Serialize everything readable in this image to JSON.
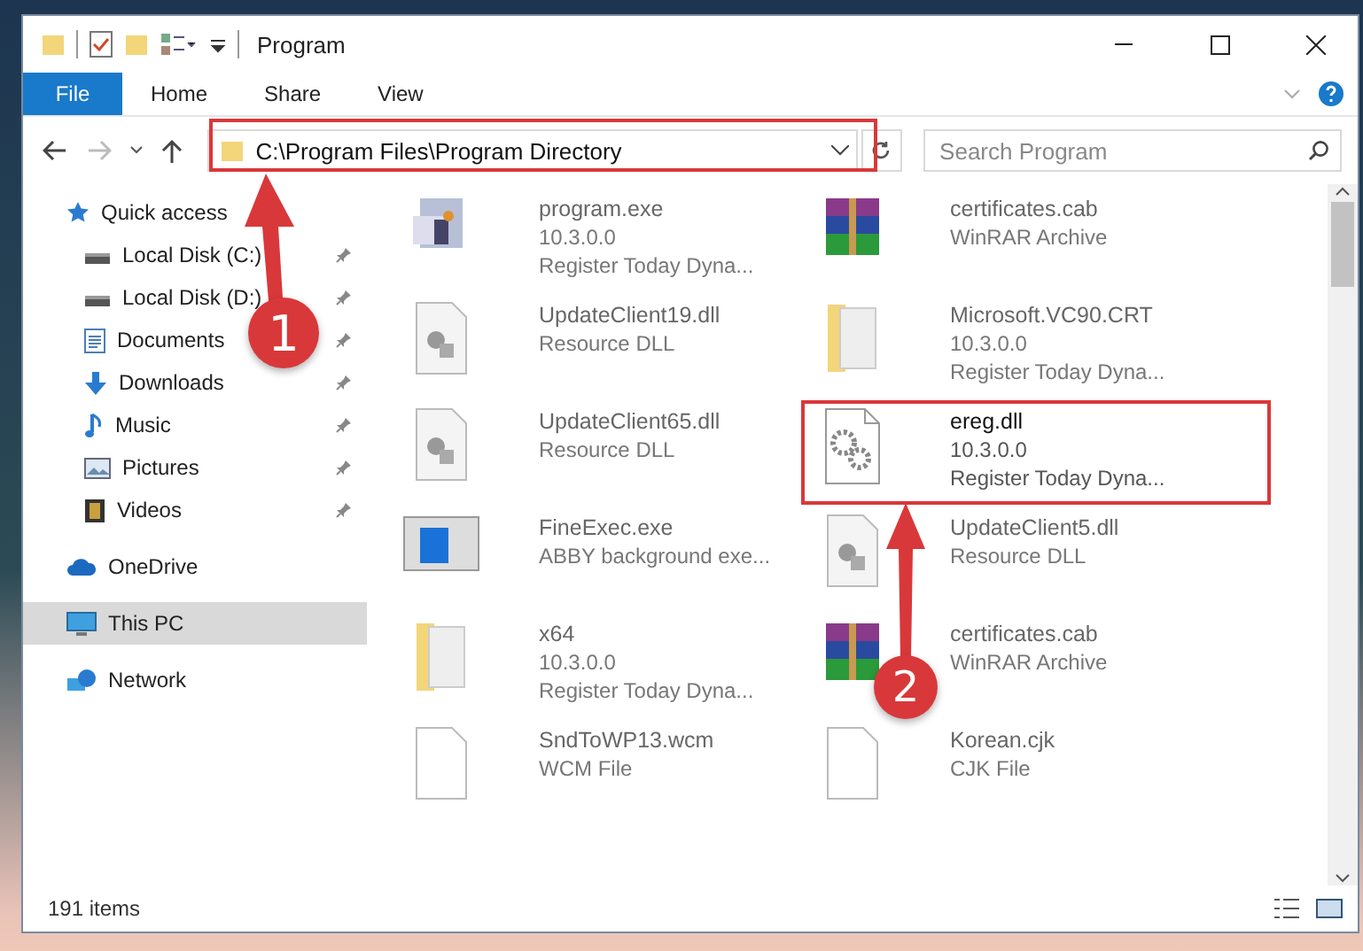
{
  "window": {
    "title": "Program"
  },
  "ribbon_tabs": [
    {
      "label": "File",
      "selected": true
    },
    {
      "label": "Home",
      "selected": false
    },
    {
      "label": "Share",
      "selected": false
    },
    {
      "label": "View",
      "selected": false
    }
  ],
  "address": {
    "path": "C:\\Program Files\\Program Directory"
  },
  "search": {
    "placeholder": "Search Program"
  },
  "sidebar": {
    "items": [
      {
        "label": "Quick access",
        "kind": "star",
        "pinned": false,
        "selected": false,
        "children": [
          {
            "label": "Local Disk (C:)",
            "kind": "disk",
            "pinned": true,
            "selected": false
          },
          {
            "label": "Local Disk (D:)",
            "kind": "disk",
            "pinned": true,
            "selected": false
          },
          {
            "label": "Documents",
            "kind": "document",
            "pinned": true,
            "selected": false
          },
          {
            "label": "Downloads",
            "kind": "download",
            "pinned": true,
            "selected": false
          },
          {
            "label": "Music",
            "kind": "music",
            "pinned": true,
            "selected": false
          },
          {
            "label": "Pictures",
            "kind": "pictures",
            "pinned": true,
            "selected": false
          },
          {
            "label": "Videos",
            "kind": "videos",
            "pinned": true,
            "selected": false
          }
        ]
      },
      {
        "label": "OneDrive",
        "kind": "cloud",
        "pinned": false,
        "selected": false
      },
      {
        "label": "This PC",
        "kind": "pc",
        "pinned": false,
        "selected": true
      },
      {
        "label": "Network",
        "kind": "network",
        "pinned": false,
        "selected": false
      }
    ]
  },
  "files": [
    {
      "name": "program.exe",
      "details": [
        "10.3.0.0",
        "Register Today Dyna..."
      ],
      "kind": "app",
      "blurred": true
    },
    {
      "name": "certificates.cab",
      "details": [
        "WinRAR Archive"
      ],
      "kind": "archive",
      "blurred": true
    },
    {
      "name": "UpdateClient19.dll",
      "details": [
        "Resource DLL"
      ],
      "kind": "dll",
      "blurred": true
    },
    {
      "name": "Microsoft.VC90.CRT",
      "details": [
        "10.3.0.0",
        "Register Today Dyna..."
      ],
      "kind": "folder",
      "blurred": true
    },
    {
      "name": "UpdateClient65.dll",
      "details": [
        "Resource DLL"
      ],
      "kind": "dll",
      "blurred": true
    },
    {
      "name": "ereg.dll",
      "details": [
        "10.3.0.0",
        "Register Today Dyna..."
      ],
      "kind": "gears",
      "blurred": false
    },
    {
      "name": "FineExec.exe",
      "details": [
        "ABBY background exe..."
      ],
      "kind": "window",
      "blurred": true
    },
    {
      "name": "UpdateClient5.dll",
      "details": [
        "Resource DLL"
      ],
      "kind": "dll",
      "blurred": true
    },
    {
      "name": "x64",
      "details": [
        "10.3.0.0",
        "Register Today Dyna..."
      ],
      "kind": "folder",
      "blurred": true
    },
    {
      "name": "certificates.cab",
      "details": [
        "WinRAR Archive"
      ],
      "kind": "archive",
      "blurred": true
    },
    {
      "name": "SndToWP13.wcm",
      "details": [
        "WCM File"
      ],
      "kind": "blank",
      "blurred": true
    },
    {
      "name": "Korean.cjk",
      "details": [
        "CJK File"
      ],
      "kind": "blank",
      "blurred": true
    }
  ],
  "status_bar": {
    "count": "191 items"
  },
  "annotations": [
    {
      "number": "1"
    },
    {
      "number": "2"
    }
  ]
}
